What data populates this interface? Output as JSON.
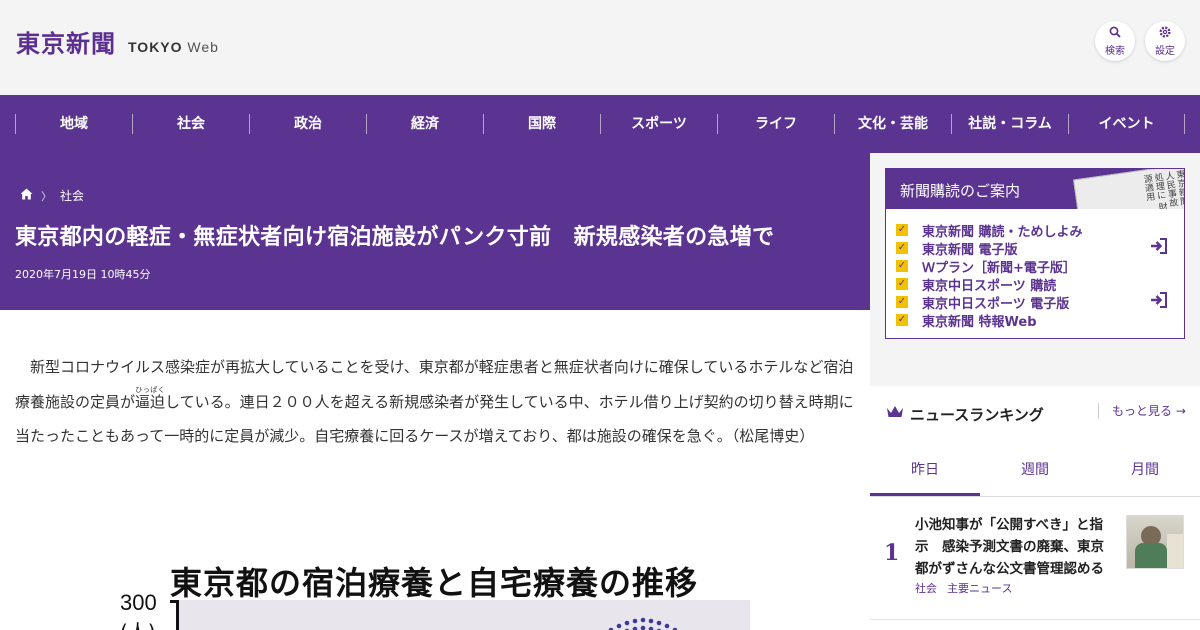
{
  "header": {
    "logo_kanji": "東京新聞",
    "logo_en": "TOKYO",
    "logo_web": "Web",
    "search_label": "検索",
    "settings_label": "設定"
  },
  "nav": [
    "地域",
    "社会",
    "政治",
    "経済",
    "国際",
    "スポーツ",
    "ライフ",
    "文化・芸能",
    "社説・コラム",
    "イベント"
  ],
  "breadcrumb": {
    "category": "社会"
  },
  "article": {
    "title": "東京都内の軽症・無症状者向け宿泊施設がパンク寸前　新規感染者の急増で",
    "date": "2020年7月19日 10時45分",
    "lead_1": "新型コロナウイルス感染症が再拡大していることを受け、東京都が軽症患者と無症状者向けに確保しているホテルなど宿泊療養施設の定員が",
    "lead_ruby_base": "逼迫",
    "lead_ruby_text": "ひっぱく",
    "lead_2": "している。連日２００人を超える新規感染者が発生している中、ホテル借り上げ契約の切り替え時期に当たったこともあって一時的に定員が減少。自宅療養に回るケースが増えており、都は施設の確保を急ぐ。（松尾博史）"
  },
  "figure": {
    "title": "東京都の宿泊療養と自宅療養の推移",
    "y_top": "300",
    "y_unit": "(人)"
  },
  "subscription": {
    "title": "新聞購読のご案内",
    "paper_text": "東京新聞 人民事故処理に 財源適用",
    "items": [
      "東京新聞 購読・ためしよみ",
      "東京新聞 電子版",
      "Ｗプラン［新聞+電子版］",
      "東京中日スポーツ 購読",
      "東京中日スポーツ 電子版",
      "東京新聞 特報Web"
    ]
  },
  "ranking": {
    "title": "ニュースランキング",
    "more": "もっと見る",
    "tabs": [
      "昨日",
      "週間",
      "月間"
    ],
    "top": {
      "rank": "1",
      "text": "小池知事が「公開すべき」と指示　感染予測文書の廃棄、東京都がずさんな公文書管理認める",
      "tags": [
        "社会",
        "主要ニュース"
      ]
    }
  },
  "colors": {
    "brand_purple": "#5b3391",
    "check_yellow": "#f2c200"
  }
}
